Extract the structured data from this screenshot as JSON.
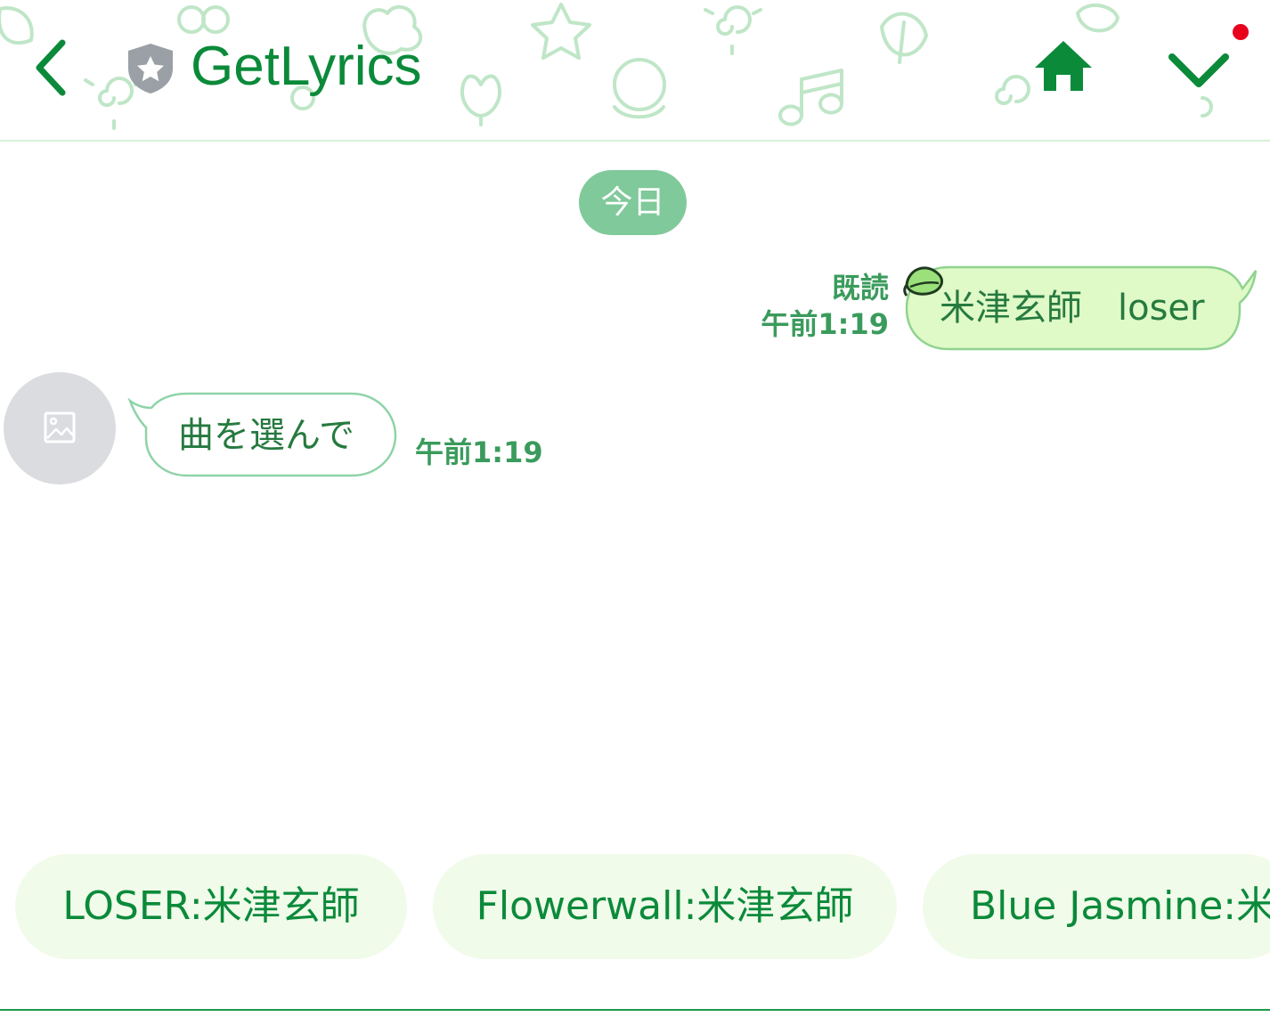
{
  "header": {
    "title": "GetLyrics",
    "back_icon": "chevron-left-icon",
    "badge_icon": "shield-star-icon",
    "home_icon": "home-icon",
    "menu_icon": "chevron-down-icon",
    "has_notification": true
  },
  "chat": {
    "date_separator": "今日",
    "messages": [
      {
        "direction": "sent",
        "text": "米津玄師　loser",
        "read_status": "既読",
        "time": "午前1:19"
      },
      {
        "direction": "received",
        "text": "曲を選んで",
        "time": "午前1:19",
        "avatar_icon": "image-placeholder-icon"
      }
    ]
  },
  "quick_replies": [
    "LOSER:米津玄師",
    "Flowerwall:米津玄師",
    "Blue Jasmine:米津玄師"
  ],
  "colors": {
    "brand_green": "#0b8a3a",
    "date_pill": "#80c99a",
    "sent_bubble": "#dff9c7",
    "quick_reply_bg": "#f0fbea",
    "notification_dot": "#e8001c"
  }
}
